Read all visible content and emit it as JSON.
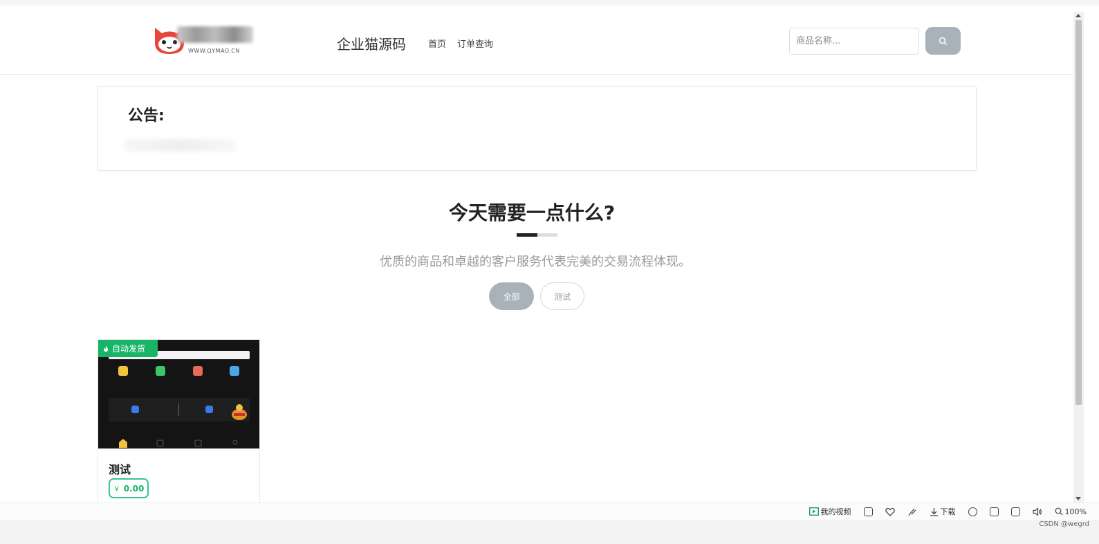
{
  "header": {
    "logo_url_text": "WWW.QYMAO.CN",
    "site_title": "企业猫源码",
    "nav": [
      "首页",
      "订单查询"
    ],
    "search_placeholder": "商品名称..."
  },
  "notice": {
    "title": "公告:"
  },
  "hero": {
    "title": "今天需要一点什么?",
    "subtitle": "优质的商品和卓越的客户服务代表完美的交易流程体现。",
    "categories": [
      "全部",
      "测试"
    ]
  },
  "product": {
    "badge": "自动发货",
    "name": "测试",
    "price": "0.00",
    "currency_symbol": "￥"
  },
  "playerbar": {
    "my_video": "我的视频",
    "download": "下载",
    "zoom": "100%"
  },
  "watermark": "CSDN @wegrd",
  "colors": {
    "accent_green": "#18b566",
    "button_gray": "#a9b2bb",
    "logo_red": "#e8453c"
  }
}
